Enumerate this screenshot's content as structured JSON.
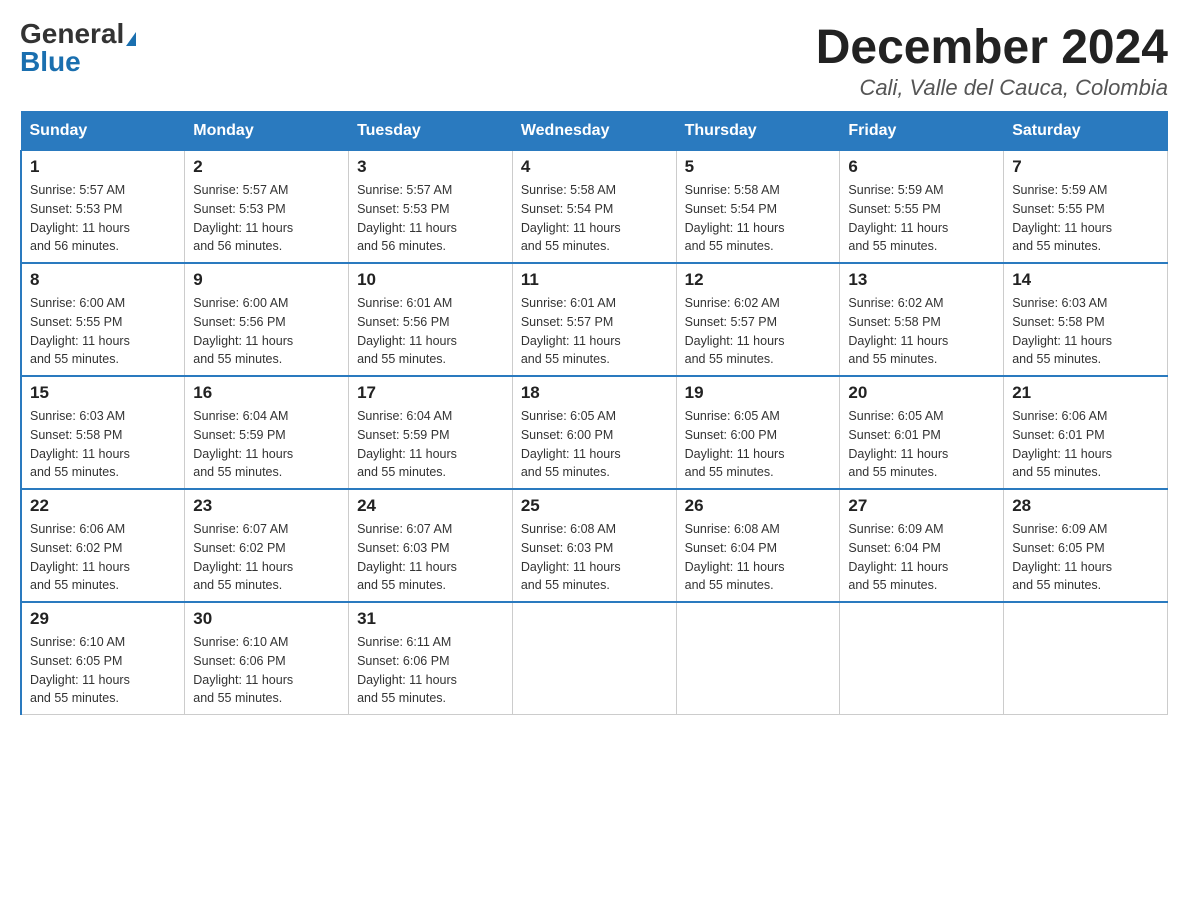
{
  "header": {
    "logo_general": "General",
    "logo_blue": "Blue",
    "month_title": "December 2024",
    "location": "Cali, Valle del Cauca, Colombia"
  },
  "weekdays": [
    "Sunday",
    "Monday",
    "Tuesday",
    "Wednesday",
    "Thursday",
    "Friday",
    "Saturday"
  ],
  "weeks": [
    [
      {
        "day": "1",
        "sunrise": "5:57 AM",
        "sunset": "5:53 PM",
        "daylight": "11 hours and 56 minutes."
      },
      {
        "day": "2",
        "sunrise": "5:57 AM",
        "sunset": "5:53 PM",
        "daylight": "11 hours and 56 minutes."
      },
      {
        "day": "3",
        "sunrise": "5:57 AM",
        "sunset": "5:53 PM",
        "daylight": "11 hours and 56 minutes."
      },
      {
        "day": "4",
        "sunrise": "5:58 AM",
        "sunset": "5:54 PM",
        "daylight": "11 hours and 55 minutes."
      },
      {
        "day": "5",
        "sunrise": "5:58 AM",
        "sunset": "5:54 PM",
        "daylight": "11 hours and 55 minutes."
      },
      {
        "day": "6",
        "sunrise": "5:59 AM",
        "sunset": "5:55 PM",
        "daylight": "11 hours and 55 minutes."
      },
      {
        "day": "7",
        "sunrise": "5:59 AM",
        "sunset": "5:55 PM",
        "daylight": "11 hours and 55 minutes."
      }
    ],
    [
      {
        "day": "8",
        "sunrise": "6:00 AM",
        "sunset": "5:55 PM",
        "daylight": "11 hours and 55 minutes."
      },
      {
        "day": "9",
        "sunrise": "6:00 AM",
        "sunset": "5:56 PM",
        "daylight": "11 hours and 55 minutes."
      },
      {
        "day": "10",
        "sunrise": "6:01 AM",
        "sunset": "5:56 PM",
        "daylight": "11 hours and 55 minutes."
      },
      {
        "day": "11",
        "sunrise": "6:01 AM",
        "sunset": "5:57 PM",
        "daylight": "11 hours and 55 minutes."
      },
      {
        "day": "12",
        "sunrise": "6:02 AM",
        "sunset": "5:57 PM",
        "daylight": "11 hours and 55 minutes."
      },
      {
        "day": "13",
        "sunrise": "6:02 AM",
        "sunset": "5:58 PM",
        "daylight": "11 hours and 55 minutes."
      },
      {
        "day": "14",
        "sunrise": "6:03 AM",
        "sunset": "5:58 PM",
        "daylight": "11 hours and 55 minutes."
      }
    ],
    [
      {
        "day": "15",
        "sunrise": "6:03 AM",
        "sunset": "5:58 PM",
        "daylight": "11 hours and 55 minutes."
      },
      {
        "day": "16",
        "sunrise": "6:04 AM",
        "sunset": "5:59 PM",
        "daylight": "11 hours and 55 minutes."
      },
      {
        "day": "17",
        "sunrise": "6:04 AM",
        "sunset": "5:59 PM",
        "daylight": "11 hours and 55 minutes."
      },
      {
        "day": "18",
        "sunrise": "6:05 AM",
        "sunset": "6:00 PM",
        "daylight": "11 hours and 55 minutes."
      },
      {
        "day": "19",
        "sunrise": "6:05 AM",
        "sunset": "6:00 PM",
        "daylight": "11 hours and 55 minutes."
      },
      {
        "day": "20",
        "sunrise": "6:05 AM",
        "sunset": "6:01 PM",
        "daylight": "11 hours and 55 minutes."
      },
      {
        "day": "21",
        "sunrise": "6:06 AM",
        "sunset": "6:01 PM",
        "daylight": "11 hours and 55 minutes."
      }
    ],
    [
      {
        "day": "22",
        "sunrise": "6:06 AM",
        "sunset": "6:02 PM",
        "daylight": "11 hours and 55 minutes."
      },
      {
        "day": "23",
        "sunrise": "6:07 AM",
        "sunset": "6:02 PM",
        "daylight": "11 hours and 55 minutes."
      },
      {
        "day": "24",
        "sunrise": "6:07 AM",
        "sunset": "6:03 PM",
        "daylight": "11 hours and 55 minutes."
      },
      {
        "day": "25",
        "sunrise": "6:08 AM",
        "sunset": "6:03 PM",
        "daylight": "11 hours and 55 minutes."
      },
      {
        "day": "26",
        "sunrise": "6:08 AM",
        "sunset": "6:04 PM",
        "daylight": "11 hours and 55 minutes."
      },
      {
        "day": "27",
        "sunrise": "6:09 AM",
        "sunset": "6:04 PM",
        "daylight": "11 hours and 55 minutes."
      },
      {
        "day": "28",
        "sunrise": "6:09 AM",
        "sunset": "6:05 PM",
        "daylight": "11 hours and 55 minutes."
      }
    ],
    [
      {
        "day": "29",
        "sunrise": "6:10 AM",
        "sunset": "6:05 PM",
        "daylight": "11 hours and 55 minutes."
      },
      {
        "day": "30",
        "sunrise": "6:10 AM",
        "sunset": "6:06 PM",
        "daylight": "11 hours and 55 minutes."
      },
      {
        "day": "31",
        "sunrise": "6:11 AM",
        "sunset": "6:06 PM",
        "daylight": "11 hours and 55 minutes."
      },
      null,
      null,
      null,
      null
    ]
  ],
  "labels": {
    "sunrise": "Sunrise:",
    "sunset": "Sunset:",
    "daylight": "Daylight:"
  }
}
